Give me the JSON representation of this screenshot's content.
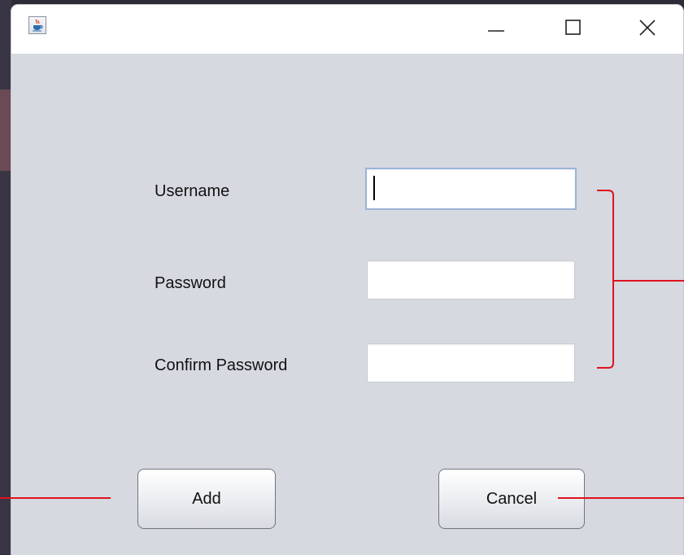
{
  "window": {
    "icon": "java-cup-icon",
    "controls": {
      "minimize": "minimize-icon",
      "maximize": "maximize-icon",
      "close": "close-icon"
    }
  },
  "form": {
    "username_label": "Username",
    "password_label": "Password",
    "confirm_label": "Confirm Password",
    "username_value": "",
    "password_value": "",
    "confirm_value": ""
  },
  "buttons": {
    "add_label": "Add",
    "cancel_label": "Cancel"
  },
  "colors": {
    "background": "#d6d9e0",
    "annotation": "#e0121f",
    "focus_border": "#9bb3d6"
  }
}
